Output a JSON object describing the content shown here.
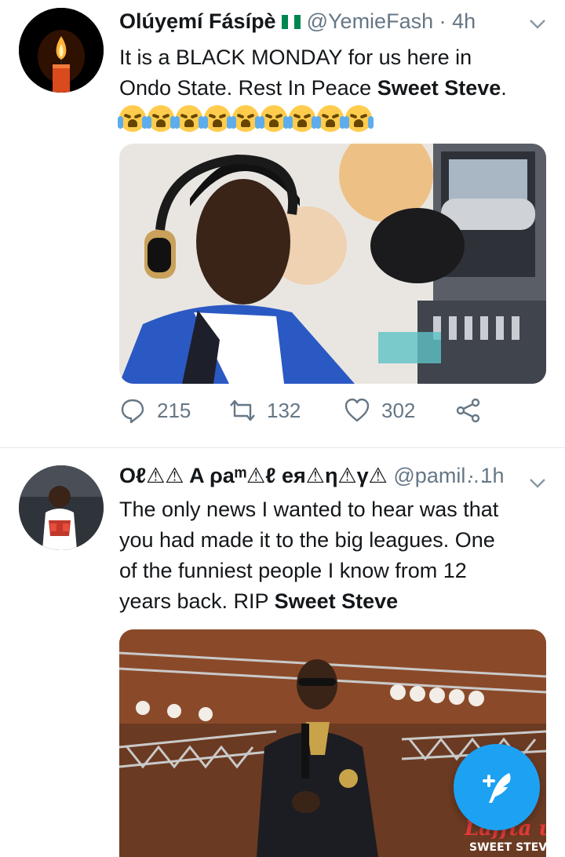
{
  "tweets": [
    {
      "name": "Olúyẹmí Fásípè",
      "flag": "🇳🇬",
      "handle": "@YemieFash",
      "separator": "·",
      "time": "4h",
      "text_line1": "It is a BLACK MONDAY for us here in",
      "text_line2_prefix": "Ondo State. Rest In Peace ",
      "text_bold": "Sweet Steve",
      "text_suffix": ".",
      "emoji_count": 9,
      "emoji_name": "loudly-crying-face",
      "actions": {
        "replies": "215",
        "retweets": "132",
        "likes": "302"
      },
      "avatar_icon": "candle-icon",
      "media_description": "man-with-headphones-at-radio-microphone"
    },
    {
      "name": "Oℓ⚠⚠ A ρaᵐ⚠ℓ eя⚠η⚠γ⚠",
      "handle": "@pamil…",
      "separator": "·",
      "time": "1h",
      "text_line1": "The only news I wanted to hear was that",
      "text_line2": "you had made it to the big leagues. One",
      "text_line3": "of the funniest people I know from 12",
      "text_line4_prefix": "years back. RIP ",
      "text_bold": "Sweet Steve",
      "media_caption_brand": "Laffta unplugged",
      "media_caption_name": "SWEET STEVE",
      "media_description": "man-with-microphone-on-stage"
    }
  ],
  "compose": {
    "icon": "compose-tweet-icon",
    "symbol": "+"
  },
  "colors": {
    "accent": "#1da1f2",
    "muted": "#657786",
    "text": "#14171a",
    "divider": "#e1e8ed"
  }
}
